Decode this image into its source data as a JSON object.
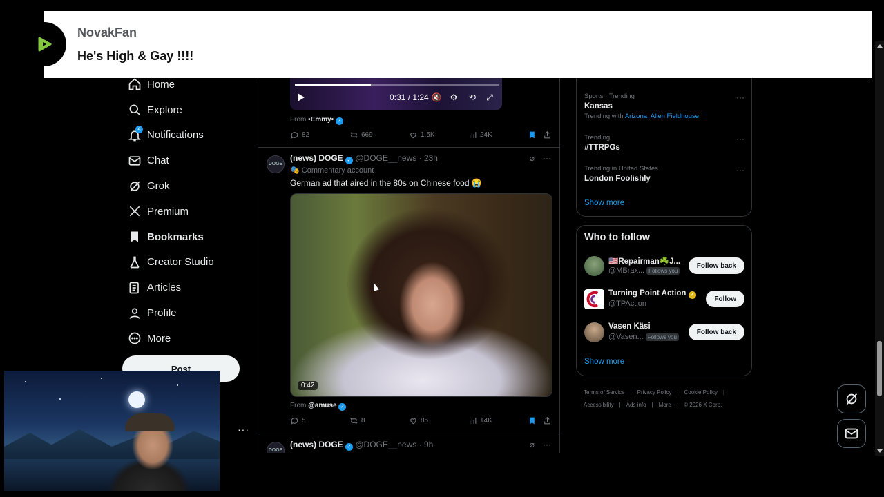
{
  "nav": {
    "items": [
      {
        "label": "Home",
        "icon": "home-icon"
      },
      {
        "label": "Explore",
        "icon": "search-icon"
      },
      {
        "label": "Notifications",
        "icon": "bell-icon",
        "badge": "4"
      },
      {
        "label": "Chat",
        "icon": "mail-icon"
      },
      {
        "label": "Grok",
        "icon": "grok-icon"
      },
      {
        "label": "Premium",
        "icon": "x-logo-icon"
      },
      {
        "label": "Bookmarks",
        "icon": "bookmark-icon"
      },
      {
        "label": "Creator Studio",
        "icon": "flask-icon"
      },
      {
        "label": "Articles",
        "icon": "article-icon"
      },
      {
        "label": "Profile",
        "icon": "person-icon"
      },
      {
        "label": "More",
        "icon": "more-circle-icon"
      }
    ],
    "post_label": "Post",
    "account_more": "···"
  },
  "feed": {
    "video_top": {
      "time": "0:31 / 1:24",
      "progress": 0.37,
      "from_prefix": "From",
      "from_name": "•Emmy•",
      "stats": {
        "replies": "82",
        "reposts": "669",
        "likes": "1.5K",
        "views": "24K"
      }
    },
    "tweet1": {
      "avatar_text": "DOGE",
      "name": "(news) DOGE",
      "handle": "@DOGE__news",
      "time": "· 23h",
      "badge": "Commentary account",
      "text": "German ad that aired in the 80s on Chinese food 😭",
      "duration": "0:42",
      "from_prefix": "From",
      "from_name": "@amuse",
      "stats": {
        "replies": "5",
        "reposts": "8",
        "likes": "85",
        "views": "14K"
      }
    },
    "tweet2": {
      "avatar_text": "DOGE",
      "name": "(news) DOGE",
      "handle": "@DOGE__news",
      "time": "· 9h"
    }
  },
  "trends": {
    "items": [
      {
        "meta": "Sports · Trending",
        "title": "Kansas",
        "with_prefix": "Trending with",
        "with_links": "Arizona, Allen Fieldhouse"
      },
      {
        "meta": "Trending",
        "title": "#TTRPGs"
      },
      {
        "meta": "Trending in United States",
        "title": "London Foolishly"
      }
    ],
    "show_more": "Show more"
  },
  "who_to_follow": {
    "title": "Who to follow",
    "items": [
      {
        "name": "🇺🇸Repairman☘️J...",
        "handle": "@MBrax...",
        "follows_you": "Follows you",
        "button": "Follow back"
      },
      {
        "name": "Turning Point Action",
        "handle": "@TPAction",
        "button": "Follow"
      },
      {
        "name": "Vasen Käsi",
        "handle": "@Vasen...",
        "follows_you": "Follows you",
        "button": "Follow back"
      }
    ],
    "show_more": "Show more"
  },
  "footer": {
    "links": [
      "Terms of Service",
      "|",
      "Privacy Policy",
      "|",
      "Cookie Policy",
      "|",
      "Accessibility",
      "|",
      "Ads info",
      "|",
      "More ···",
      "© 2026 X Corp."
    ]
  },
  "overlay": {
    "username": "NovakFan",
    "message": "He's High & Gay !!!!"
  },
  "colors": {
    "accent": "#1d9bf0",
    "background": "#000000",
    "border": "#2f3336",
    "muted": "#71767b",
    "gold_verified": "#e2b719"
  }
}
